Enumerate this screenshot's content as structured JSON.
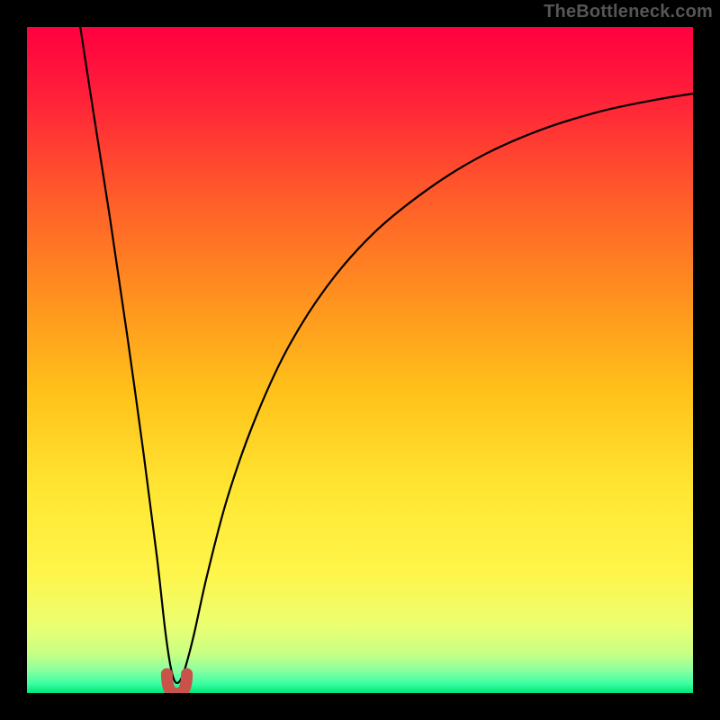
{
  "watermark": "TheBottleneck.com",
  "chart_data": {
    "type": "line",
    "title": "",
    "xlabel": "",
    "ylabel": "",
    "xlim": [
      0,
      100
    ],
    "ylim": [
      0,
      100
    ],
    "grid": false,
    "background": {
      "type": "vertical-gradient",
      "stops": [
        {
          "pos": 0.0,
          "color": "#ff0040"
        },
        {
          "pos": 0.1,
          "color": "#ff1f3a"
        },
        {
          "pos": 0.25,
          "color": "#ff5a2a"
        },
        {
          "pos": 0.4,
          "color": "#ff8f1f"
        },
        {
          "pos": 0.55,
          "color": "#ffc21a"
        },
        {
          "pos": 0.7,
          "color": "#ffe733"
        },
        {
          "pos": 0.82,
          "color": "#fff54a"
        },
        {
          "pos": 0.9,
          "color": "#eaff73"
        },
        {
          "pos": 0.94,
          "color": "#c9ff83"
        },
        {
          "pos": 0.965,
          "color": "#8dffa0"
        },
        {
          "pos": 0.985,
          "color": "#3fffa3"
        },
        {
          "pos": 1.0,
          "color": "#00e67a"
        }
      ]
    },
    "series": [
      {
        "name": "curve",
        "x": [
          8.0,
          10.0,
          12.5,
          15.0,
          17.5,
          19.5,
          20.8,
          21.7,
          22.5,
          23.5,
          25.0,
          27.0,
          30.0,
          34.0,
          39.0,
          45.0,
          52.0,
          60.0,
          68.0,
          77.0,
          86.0,
          94.0,
          100.0
        ],
        "values": [
          100.0,
          87.0,
          71.0,
          54.0,
          36.0,
          20.5,
          9.0,
          3.3,
          1.5,
          3.0,
          8.5,
          17.5,
          29.0,
          40.5,
          51.5,
          61.0,
          69.0,
          75.5,
          80.5,
          84.5,
          87.3,
          89.0,
          90.0
        ]
      }
    ],
    "min_marker": {
      "x_range": [
        21.0,
        24.0
      ],
      "y": 1.5,
      "color": "#c9524b"
    }
  }
}
